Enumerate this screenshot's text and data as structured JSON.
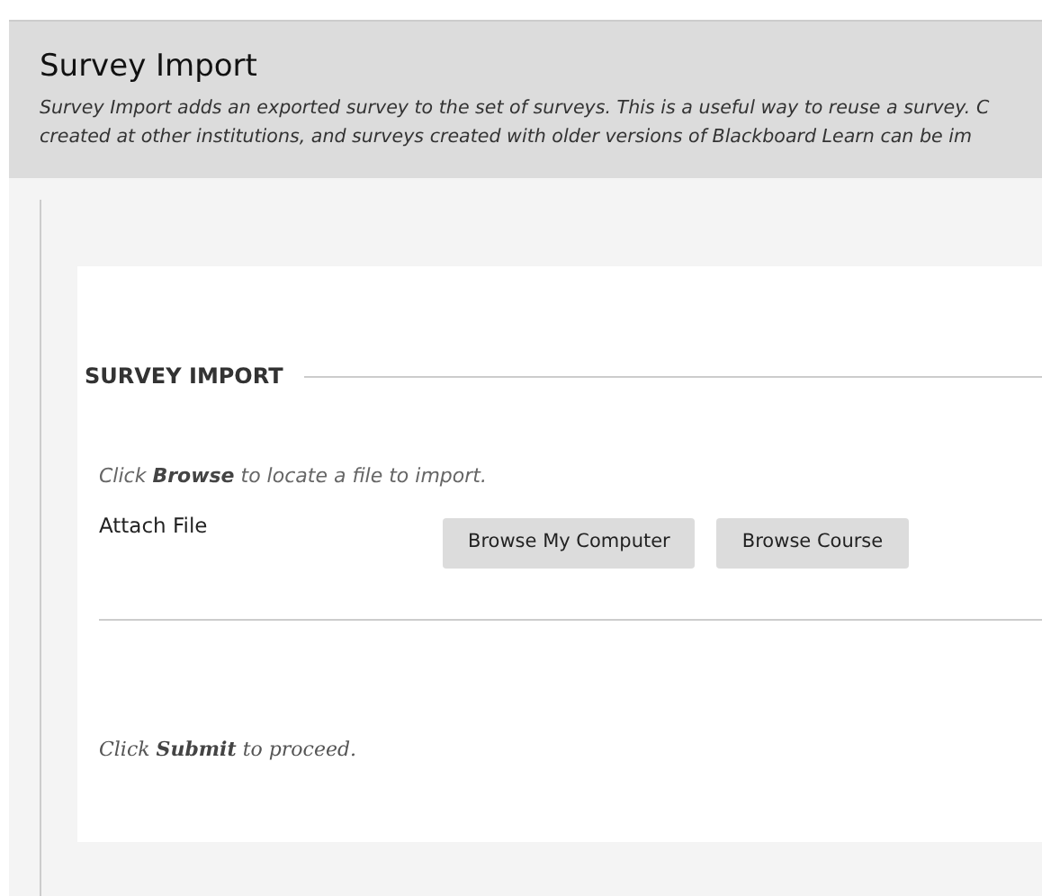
{
  "header": {
    "title": "Survey Import",
    "description_lines": [
      "Survey Import adds an exported survey to the set of surveys. This is a useful way to reuse a survey. C",
      "created at other institutions, and surveys created with older versions of Blackboard Learn can be im"
    ]
  },
  "section": {
    "heading": "SURVEY IMPORT",
    "instruction": "Click **Browse** to locate a file to import.",
    "field_label": "Attach File",
    "buttons": [
      "Browse My Computer",
      "Browse Course"
    ]
  },
  "footer_instruction": "Click **Submit** to proceed."
}
